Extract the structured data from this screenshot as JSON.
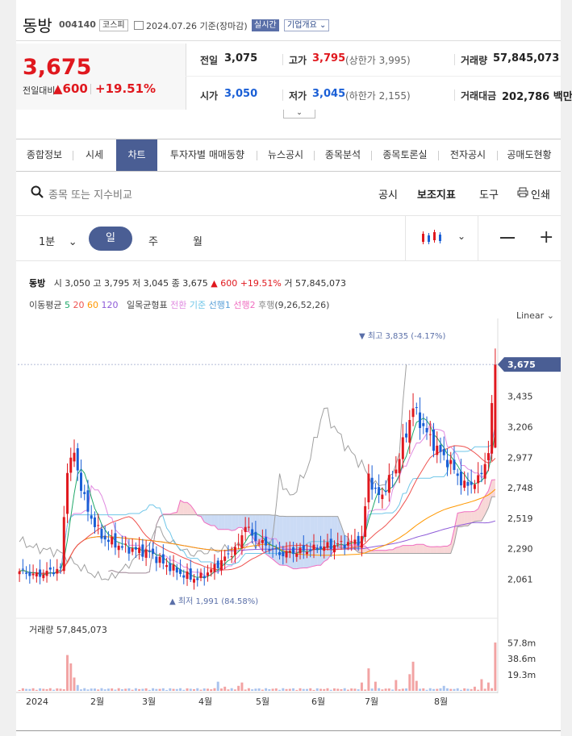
{
  "header": {
    "name": "동방",
    "code": "004140",
    "market": "코스피",
    "date": "2024.07.26",
    "date_suffix": "기준(장마감)",
    "realtime": "실시간",
    "company": "기업개요"
  },
  "quote": {
    "price": "3,675",
    "change_label": "전일대비",
    "change": "600",
    "change_pct": "+19.51%",
    "prev_label": "전일",
    "prev": "3,075",
    "high_label": "고가",
    "high": "3,795",
    "upper_limit": "(상한가 3,995)",
    "volume_label": "거래량",
    "volume": "57,845,073",
    "open_label": "시가",
    "open": "3,050",
    "low_label": "저가",
    "low": "3,045",
    "lower_limit": "(하한가 2,155)",
    "amount_label": "거래대금",
    "amount": "202,786 백만"
  },
  "tabs": [
    "종합정보",
    "시세",
    "차트",
    "투자자별 매매동향",
    "뉴스공시",
    "종목분석",
    "종목토론실",
    "전자공시",
    "공매도현황"
  ],
  "toolbar": {
    "search_placeholder": "종목 또는 지수비교",
    "notice": "공시",
    "indicator": "보조지표",
    "tools": "도구",
    "print": "인쇄",
    "period_min": "1분",
    "period_day": "일",
    "period_week": "주",
    "period_month": "월"
  },
  "info_line": {
    "name": "동방",
    "open_l": "시",
    "open": "3,050",
    "high_l": "고",
    "high": "3,795",
    "low_l": "저",
    "low": "3,045",
    "close_l": "종",
    "close": "3,675",
    "change": "▲ 600",
    "pct": "+19.51%",
    "vol_l": "거",
    "vol": "57,845,073"
  },
  "ma_line": {
    "label": "이동평균",
    "p5": "5",
    "p20": "20",
    "p60": "60",
    "p120": "120",
    "ichimoku": "일목균형표",
    "tenkan": "전환",
    "kijun": "기준",
    "span1": "선행1",
    "span2": "선행2",
    "chikou": "후행",
    "params": "(9,26,52,26)"
  },
  "scale_label": "Linear",
  "colors": {
    "up": "#e0181e",
    "down": "#1a5fd6",
    "accent": "#4a5e94",
    "ma5": "#20a96a",
    "ma20": "#ef5350",
    "ma60": "#ff9800",
    "ma120": "#8e5bd8",
    "tenkan": "#e08ae0",
    "kijun": "#6fc6e8",
    "span1": "#f06ec0",
    "span2": "#a0a0a0"
  },
  "chart_data": {
    "type": "candlestick",
    "y_ticks": [
      "3,435",
      "3,206",
      "2,977",
      "2,748",
      "2,519",
      "2,290",
      "2,061"
    ],
    "y_range": [
      1900,
      3900
    ],
    "last_price_label": "3,675",
    "max_label": "▼ 최고 3,835 (-4.17%)",
    "min_label": "▲ 최저 1,991 (84.58%)",
    "x_labels": [
      "2024",
      "2월",
      "3월",
      "4월",
      "5월",
      "6월",
      "7월",
      "8월"
    ],
    "volume_label": "거래량",
    "volume_value": "57,845,073",
    "volume_ticks": [
      "57.8m",
      "38.6m",
      "19.3m"
    ],
    "anchors": [
      [
        0,
        2120
      ],
      [
        5,
        2090
      ],
      [
        12,
        2140
      ],
      [
        14,
        2900
      ],
      [
        16,
        3000
      ],
      [
        18,
        2760
      ],
      [
        20,
        2570
      ],
      [
        24,
        2380
      ],
      [
        30,
        2300
      ],
      [
        38,
        2260
      ],
      [
        42,
        2180
      ],
      [
        48,
        2090
      ],
      [
        52,
        2060
      ],
      [
        56,
        2130
      ],
      [
        60,
        2220
      ],
      [
        64,
        2310
      ],
      [
        66,
        2480
      ],
      [
        68,
        2380
      ],
      [
        71,
        2330
      ],
      [
        76,
        2250
      ],
      [
        84,
        2280
      ],
      [
        92,
        2320
      ],
      [
        96,
        2330
      ],
      [
        100,
        2360
      ],
      [
        102,
        2850
      ],
      [
        104,
        2700
      ],
      [
        106,
        2700
      ],
      [
        110,
        2890
      ],
      [
        115,
        3350
      ],
      [
        118,
        3200
      ],
      [
        122,
        3040
      ],
      [
        126,
        2920
      ],
      [
        130,
        2760
      ],
      [
        134,
        2800
      ],
      [
        137,
        3010
      ],
      [
        139,
        3675
      ]
    ],
    "volume_spikes": [
      [
        14,
        43
      ],
      [
        15,
        33
      ],
      [
        16,
        16
      ],
      [
        17,
        7
      ],
      [
        32,
        3
      ],
      [
        58,
        11
      ],
      [
        60,
        5
      ],
      [
        64,
        6
      ],
      [
        65,
        10
      ],
      [
        100,
        10
      ],
      [
        102,
        27
      ],
      [
        104,
        11
      ],
      [
        110,
        13
      ],
      [
        114,
        20
      ],
      [
        115,
        35
      ],
      [
        116,
        12
      ],
      [
        124,
        6
      ],
      [
        133,
        5
      ],
      [
        135,
        14
      ],
      [
        137,
        10
      ],
      [
        139,
        58
      ]
    ]
  }
}
